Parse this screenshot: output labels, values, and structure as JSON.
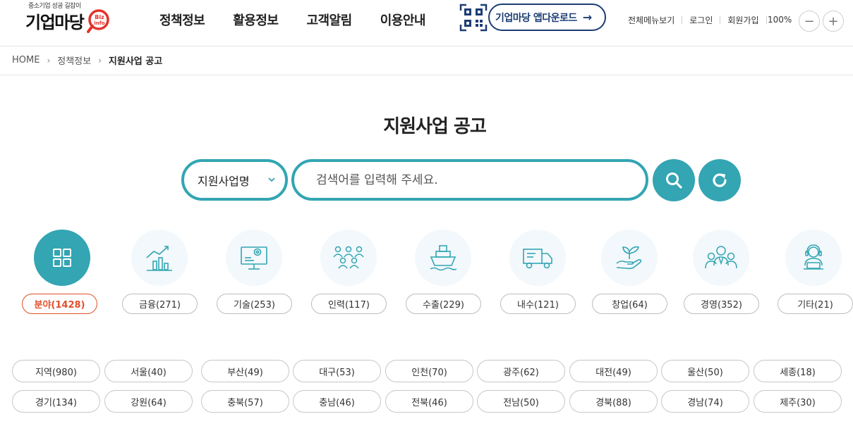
{
  "logo": {
    "tagline": "중소기업 성공 길잡이",
    "name": "기업마당",
    "mark_line1": "Biz",
    "mark_line2": "info"
  },
  "gnb": [
    "정책정보",
    "활용정보",
    "고객알림",
    "이용안내"
  ],
  "app_download": {
    "label": "기업마당 앱다운로드",
    "arrow": "→"
  },
  "util": {
    "all_menu": "전체메뉴보기",
    "login": "로그인",
    "signup": "회원가입",
    "zoom": "100%",
    "zoom_out": "−",
    "zoom_in": "+"
  },
  "breadcrumb": {
    "home": "HOME",
    "sep": "›",
    "level1": "정책정보",
    "current": "지원사업 공고"
  },
  "title": "지원사업 공고",
  "search": {
    "select_value": "지원사업명",
    "placeholder": "검색어를 입력해 주세요."
  },
  "categories": [
    {
      "label": "분야(1428)",
      "icon": "grid-icon"
    },
    {
      "label": "금융(271)",
      "icon": "chart-icon"
    },
    {
      "label": "기술(253)",
      "icon": "monitor-gear-icon"
    },
    {
      "label": "인력(117)",
      "icon": "people-icon"
    },
    {
      "label": "수출(229)",
      "icon": "ship-icon"
    },
    {
      "label": "내수(121)",
      "icon": "truck-icon"
    },
    {
      "label": "창업(64)",
      "icon": "sprout-hand-icon"
    },
    {
      "label": "경영(352)",
      "icon": "team-icon"
    },
    {
      "label": "기타(21)",
      "icon": "operator-icon"
    }
  ],
  "regions": [
    [
      "지역(980)",
      "서울(40)",
      "부산(49)",
      "대구(53)",
      "인천(70)",
      "광주(62)",
      "대전(49)",
      "울산(50)",
      "세종(18)"
    ],
    [
      "경기(134)",
      "강원(64)",
      "충북(57)",
      "충남(46)",
      "전북(46)",
      "전남(50)",
      "경북(88)",
      "경남(74)",
      "제주(30)"
    ]
  ],
  "colors": {
    "accent": "#33a5b3",
    "active": "#e0502b",
    "navy": "#1c3d73",
    "logo_red": "#e4322b"
  }
}
